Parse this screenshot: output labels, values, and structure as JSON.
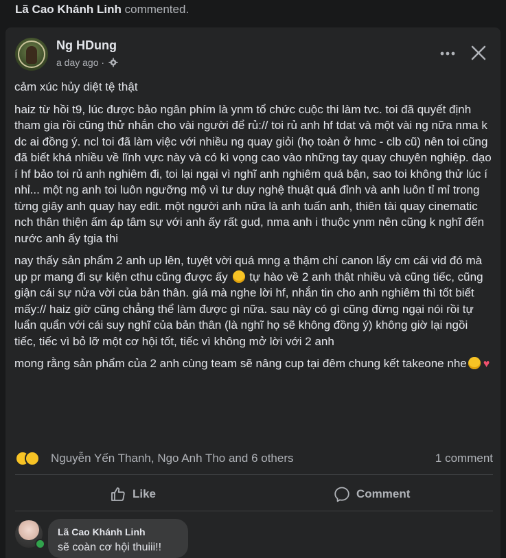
{
  "notification": {
    "commenter": "Lã Cao Khánh Linh",
    "action": "commented."
  },
  "post": {
    "author": "Ng HDung",
    "timestamp": "a day ago",
    "privacy_icon": "gear-icon",
    "paragraphs": [
      "cảm xúc hủy diệt tệ thật",
      "haiz từ hồi t9, lúc được bảo ngân phím là ynm tổ chức cuộc thi làm tvc. toi đã quyết định tham gia rồi cũng thử nhắn cho vài người để rủ:// toi rủ anh hf tdat và một vài ng nữa nma k dc ai đồng ý. ncl toi đã làm việc với nhiều ng quay giỏi (họ toàn ở hmc - clb cũ) nên toi cũng đã biết khá nhiều về lĩnh vực này và có kì vọng cao vào những tay quay chuyên nghiệp. dạo í hf bảo toi rủ anh nghiêm đi, toi lại ngại vì nghĩ anh nghiêm quá bận, sao toi không thử lúc í nhỉ... một ng anh toi luôn ngưỡng mộ vì tư duy nghệ thuật quá đỉnh và anh luôn tỉ mỉ trong từng giây anh quay hay edit. một người anh nữa là anh tuấn anh, thiên tài quay cinematic nch thân thiện ấm áp tâm sự với anh ấy rất gud, nma anh i thuộc ynm nên cũng k nghĩ đến nước anh ấy tgia thi"
    ],
    "paragraph3_part1": "nay thấy sản phẩm 2 anh up lên, tuyệt vời quá mng ạ thậm chí canon lấy cm cái vid đó mà up pr mang đi sự kiện cthu cũng được ấy",
    "paragraph3_part2": "tự hào về 2 anh thật nhiều và cũng tiếc, cũng giận cái sự nửa vời của bản thân. giá mà nghe lời hf, nhắn tin cho anh nghiêm thì tốt biết mấy:// haiz giờ cũng chẳng thể làm được gì nữa. sau này có gì cũng đừng ngại nói rồi tự luẩn quẩn với cái suy nghĩ của bản thân (là nghĩ họ sẽ không đồng ý) không giờ lại ngồi tiếc, tiếc vì bỏ lỡ một cơ hội tốt, tiếc vì không mở lời với 2 anh",
    "paragraph4": "mong rằng sản phẩm của 2 anh cùng team sẽ nâng cup tại đêm chung kết takeone nhe"
  },
  "reactions": {
    "names": "Nguyễn Yến Thanh, Ngo Anh Tho and 6 others",
    "comment_count": "1 comment"
  },
  "actions": {
    "like": "Like",
    "comment": "Comment"
  },
  "comment": {
    "author": "Lã Cao Khánh Linh",
    "text": "sẽ coàn cơ hội thuiii!!"
  },
  "colors": {
    "background": "#18191a",
    "card": "#242526",
    "bubble": "#3a3b3c",
    "text_primary": "#e4e6eb",
    "text_secondary": "#b0b3b8",
    "online": "#31a24c"
  }
}
